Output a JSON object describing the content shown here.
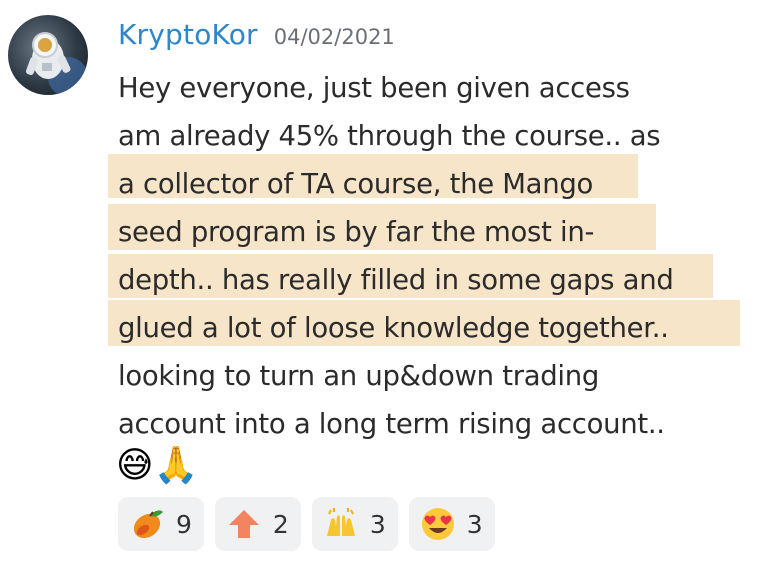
{
  "message": {
    "author": "KryptoKor",
    "timestamp": "04/02/2021",
    "lines": [
      "Hey everyone, just been given access",
      "am already 45% through the course.. as",
      "a collector of TA course, the Mango",
      "seed program is by far the most in-",
      "depth.. has really filled in some gaps and",
      "glued a lot of loose knowledge together..",
      " looking to turn an up&down trading",
      "account into a long term rising account.."
    ],
    "emojis": [
      "😅",
      "🙏"
    ],
    "highlight_color": "#f7e4c6"
  },
  "reactions": [
    {
      "icon": "mango-icon",
      "count": "9"
    },
    {
      "icon": "up-arrow-icon",
      "count": "2"
    },
    {
      "icon": "raised-hands-icon",
      "count": "3"
    },
    {
      "icon": "heart-eyes-icon",
      "count": "3"
    }
  ],
  "colors": {
    "username": "#2f86c8",
    "timestamp": "#6a6f75",
    "text": "#2b2b2b",
    "reaction_bg": "#f0f1f3"
  }
}
